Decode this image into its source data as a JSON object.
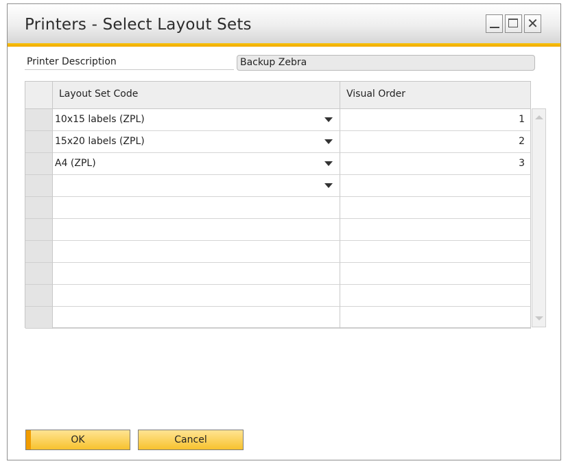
{
  "window": {
    "title": "Printers - Select Layout Sets",
    "accent_color": "#f5b400",
    "controls": {
      "minimize_icon": "minimize-icon",
      "maximize_icon": "maximize-icon",
      "close_glyph": "✕"
    }
  },
  "header_fields": {
    "printer_description_label": "Printer Description",
    "printer_description_value": "Backup Zebra"
  },
  "grid": {
    "columns": [
      "Layout Set Code",
      "Visual Order"
    ],
    "rows": [
      {
        "code": "10x15 labels (ZPL)",
        "order": "1"
      },
      {
        "code": "15x20 labels (ZPL)",
        "order": "2"
      },
      {
        "code": "A4 (ZPL)",
        "order": "3"
      },
      {
        "code": "",
        "order": ""
      },
      {
        "code": "",
        "order": ""
      },
      {
        "code": "",
        "order": ""
      },
      {
        "code": "",
        "order": ""
      },
      {
        "code": "",
        "order": ""
      },
      {
        "code": "",
        "order": ""
      },
      {
        "code": "",
        "order": ""
      }
    ]
  },
  "buttons": {
    "ok": "OK",
    "cancel": "Cancel"
  }
}
